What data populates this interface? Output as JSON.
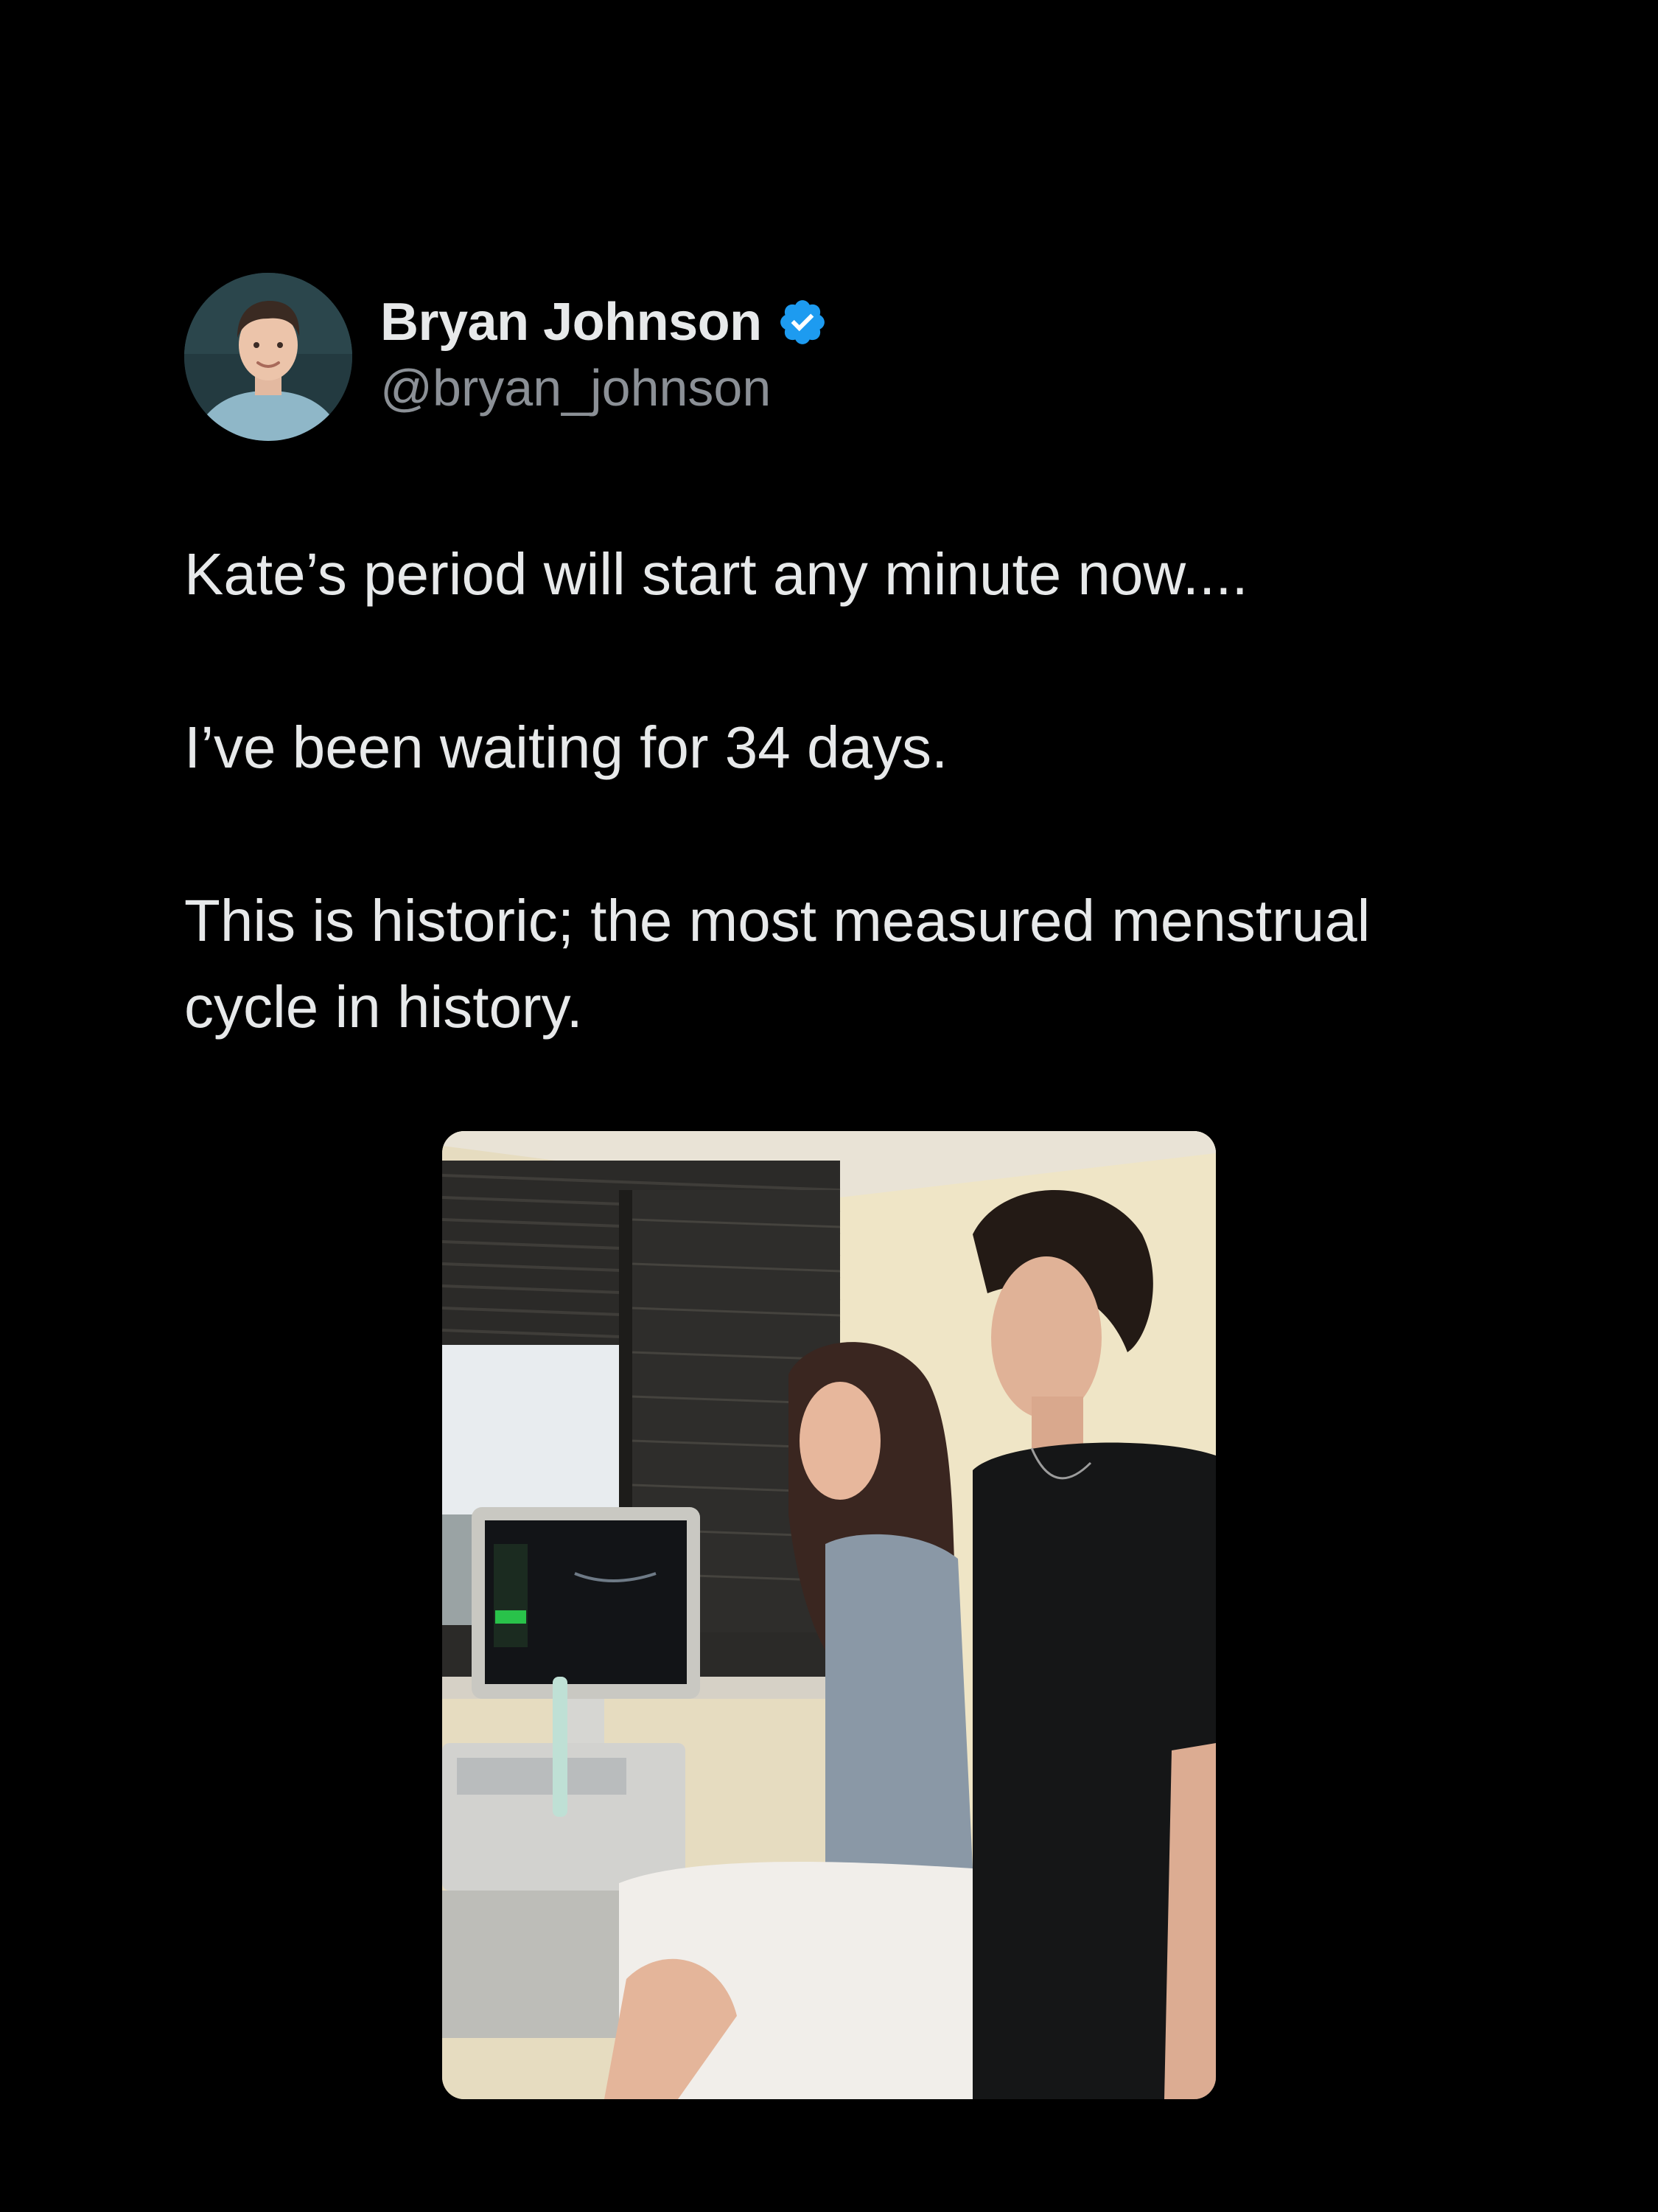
{
  "author": {
    "display_name": "Bryan Johnson",
    "handle": "@bryan_johnson",
    "verified": true,
    "avatar_icon": "profile-photo",
    "verified_icon": "verified-badge-icon",
    "verified_color": "#1d9bf0"
  },
  "tweet": {
    "paragraphs": [
      "Kate’s period will start any minute now....",
      "I’ve been waiting for 34 days.",
      "This is historic; the most measured menstrual cycle in history."
    ]
  },
  "media": {
    "kind": "photo",
    "icon": "clinic-ultrasound-photo"
  },
  "colors": {
    "background": "#000000",
    "text_primary": "#e7e9ea",
    "text_secondary": "#8b9096",
    "accent": "#1d9bf0"
  }
}
